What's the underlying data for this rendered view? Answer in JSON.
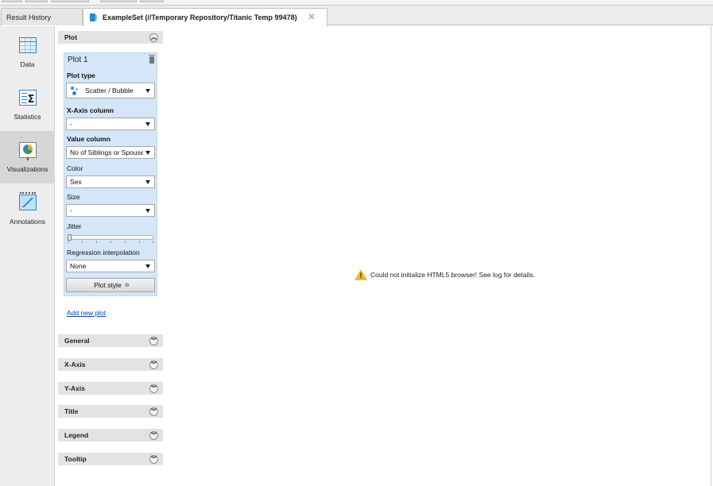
{
  "tabs": {
    "result_history": "Result History",
    "active_tab": "ExampleSet (//Temporary Repository/Titanic Temp 99478)",
    "close_symbol": "✕"
  },
  "sidebar": {
    "items": [
      {
        "label": "Data",
        "icon": "data-table-icon"
      },
      {
        "label": "Statistics",
        "icon": "statistics-icon"
      },
      {
        "label": "Visualizations",
        "icon": "visualizations-icon"
      },
      {
        "label": "Annotations",
        "icon": "annotations-icon"
      }
    ],
    "active": "Visualizations"
  },
  "panel": {
    "plot_section": "Plot",
    "plot": {
      "title": "Plot 1",
      "plot_type_label": "Plot type",
      "plot_type_value": "Scatter / Bubble",
      "x_axis_label": "X-Axis column",
      "x_axis_value": "-",
      "value_column_label": "Value column",
      "value_column_value": "No of Siblings or Spouses o",
      "color_label": "Color",
      "color_value": "Sex",
      "size_label": "Size",
      "size_value": "-",
      "jitter_label": "Jitter",
      "jitter_value": 0,
      "regression_label": "Regression interpolation",
      "regression_value": "None",
      "plot_style_button": "Plot style"
    },
    "add_new_plot": "Add new plot",
    "sections": [
      "General",
      "X-Axis",
      "Y-Axis",
      "Title",
      "Legend",
      "Tooltip"
    ]
  },
  "message": "Could not initialize HTML5 browser! See log for details.",
  "colors": {
    "accent": "#2d86c9",
    "panel_blue": "#d4e6f7",
    "warning": "#f1b82d",
    "link": "#0645ad"
  }
}
